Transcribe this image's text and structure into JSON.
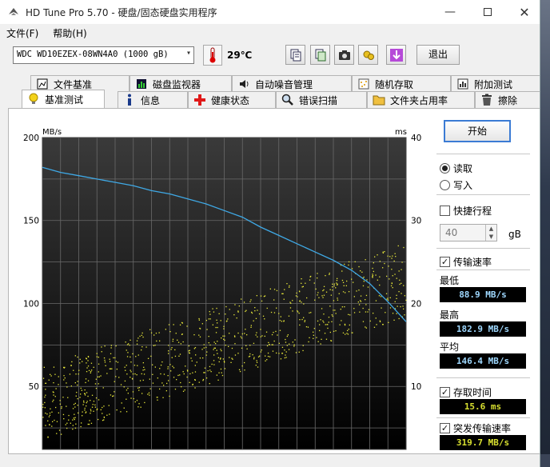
{
  "window": {
    "title": "HD Tune Pro 5.70 - 硬盘/固态硬盘实用程序"
  },
  "menu": [
    {
      "label": "文件(F)"
    },
    {
      "label": "帮助(H)"
    }
  ],
  "toolbar": {
    "drive": "WDC WD10EZEX-08WN4A0 (1000 gB)",
    "temperature": "29℃",
    "exit_label": "退出"
  },
  "tabs_row1": [
    {
      "label": "文件基准",
      "icon": "file-benchmark-icon"
    },
    {
      "label": "磁盘监视器",
      "icon": "disk-monitor-icon"
    },
    {
      "label": "自动噪音管理",
      "icon": "speaker-icon"
    },
    {
      "label": "随机存取",
      "icon": "random-access-icon"
    },
    {
      "label": "附加测试",
      "icon": "extra-tests-icon"
    }
  ],
  "tabs_row2": [
    {
      "label": "基准测试",
      "icon": "bulb-icon",
      "active": true
    },
    {
      "label": "信息",
      "icon": "info-icon"
    },
    {
      "label": "健康状态",
      "icon": "health-cross-icon"
    },
    {
      "label": "错误扫描",
      "icon": "magnifier-icon"
    },
    {
      "label": "文件夹占用率",
      "icon": "folder-icon"
    },
    {
      "label": "擦除",
      "icon": "trash-icon"
    }
  ],
  "panel": {
    "start_label": "开始",
    "read_label": "读取",
    "write_label": "写入",
    "mode": "read",
    "quick_label": "快捷行程",
    "quick_checked": false,
    "quick_value": "40",
    "quick_unit": "gB",
    "transfer_label": "传输速率",
    "transfer_checked": true,
    "min_label": "最低",
    "min_value": "88.9 MB/s",
    "max_label": "最高",
    "max_value": "182.9 MB/s",
    "avg_label": "平均",
    "avg_value": "146.4 MB/s",
    "access_label": "存取时间",
    "access_checked": true,
    "access_value": "15.6 ms",
    "burst_label": "突发传输速率",
    "burst_checked": true,
    "burst_value": "319.7 MB/s"
  },
  "colors": {
    "transfer_line": "#3fa9e6",
    "access_points": "#e8e83a",
    "chart_bg": "#000000"
  },
  "chart_data": {
    "type": "line",
    "y_left_label": "MB/s",
    "y_right_label": "ms",
    "y_left_ticks": [
      50,
      100,
      150,
      200
    ],
    "y_right_ticks": [
      10,
      20,
      30,
      40
    ],
    "ylim_left": [
      0,
      200
    ],
    "ylim_right": [
      0,
      40
    ],
    "xlim": [
      0,
      100
    ],
    "grid": true,
    "series": [
      {
        "x": [
          0,
          5,
          10,
          15,
          20,
          25,
          30,
          35,
          40,
          45,
          50,
          55,
          60,
          65,
          70,
          75,
          80,
          85,
          90,
          95,
          100
        ],
        "values": [
          182,
          179,
          177,
          175,
          173,
          171,
          168,
          166,
          163,
          160,
          156,
          152,
          146,
          141,
          136,
          131,
          126,
          120,
          112,
          101,
          89
        ]
      }
    ],
    "scatter_summary": {
      "avg_ms": 15.6
    }
  }
}
